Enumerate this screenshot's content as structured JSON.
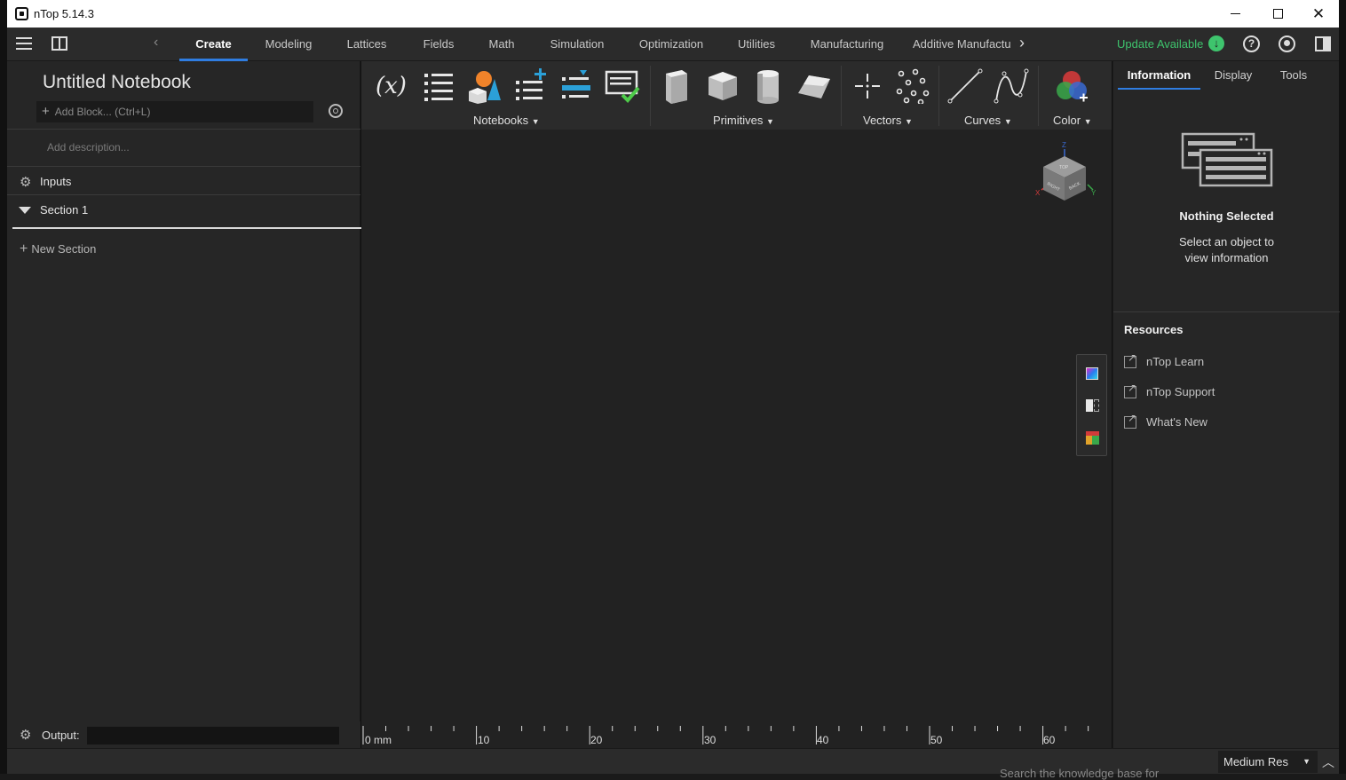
{
  "window": {
    "title": "nTop 5.14.3",
    "min_icon": "minimize-icon",
    "max_icon": "maximize-icon",
    "close_icon": "close-icon"
  },
  "menu": {
    "tabs": [
      {
        "label": "Create",
        "active": true
      },
      {
        "label": "Modeling"
      },
      {
        "label": "Lattices"
      },
      {
        "label": "Fields"
      },
      {
        "label": "Math"
      },
      {
        "label": "Simulation"
      },
      {
        "label": "Optimization"
      },
      {
        "label": "Utilities"
      },
      {
        "label": "Manufacturing"
      },
      {
        "label": "Additive Manufactu"
      }
    ],
    "update_label": "Update Available",
    "accent": "#2f7de1",
    "update_color": "#3ec46d"
  },
  "notebook": {
    "title": "Untitled Notebook",
    "add_block_placeholder": "Add Block... (Ctrl+L)",
    "description_placeholder": "Add description...",
    "inputs_label": "Inputs",
    "section_label": "Section 1",
    "new_section_label": "New Section",
    "output_label": "Output:"
  },
  "ribbon": {
    "groups": [
      {
        "label": "Notebooks"
      },
      {
        "label": "Primitives"
      },
      {
        "label": "Vectors"
      },
      {
        "label": "Curves"
      },
      {
        "label": "Color"
      }
    ],
    "variable_icon_text": "(x)"
  },
  "viewport": {
    "cube_faces": [
      "TOP",
      "RIGHT",
      "BACK"
    ],
    "axis_labels": [
      "Z",
      "X",
      "Y"
    ],
    "ruler": {
      "unit": "mm",
      "labels": [
        "0 mm",
        "10",
        "20",
        "30",
        "40",
        "50",
        "60"
      ]
    }
  },
  "right_panel": {
    "tabs": [
      {
        "label": "Information",
        "active": true
      },
      {
        "label": "Display"
      },
      {
        "label": "Tools"
      }
    ],
    "nothing_selected": "Nothing Selected",
    "hint_line1": "Select an object to",
    "hint_line2": "view information",
    "resources_title": "Resources",
    "links": [
      {
        "label": "nTop Learn"
      },
      {
        "label": "nTop Support"
      },
      {
        "label": "What's New"
      }
    ]
  },
  "status": {
    "resolution": "Medium Res"
  },
  "desktop": {
    "bottom_text": "Search the knowledge base for"
  }
}
